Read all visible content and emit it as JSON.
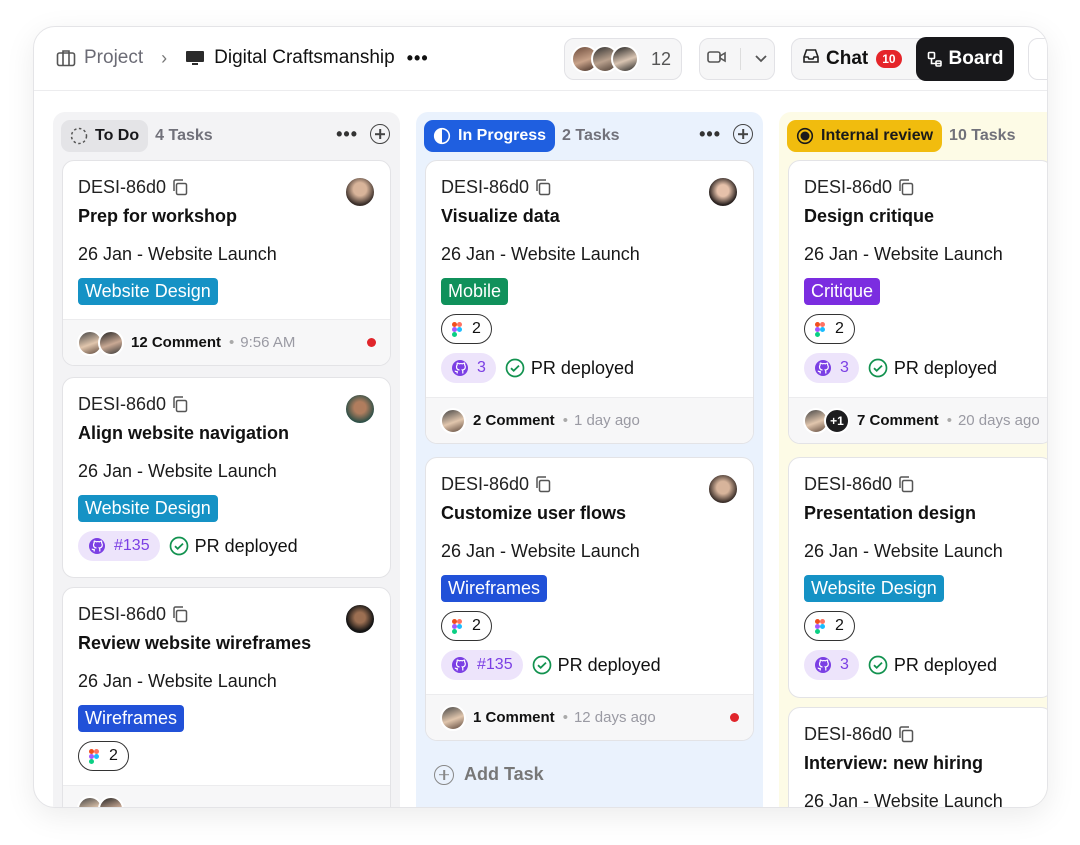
{
  "breadcrumb": {
    "root": "Project",
    "current": "Digital Craftsmanship"
  },
  "header": {
    "member_count": "12",
    "chat_label": "Chat",
    "chat_badge": "10",
    "board_label": "Board"
  },
  "columns": [
    {
      "title": "To Do",
      "count": "4 Tasks",
      "color": "#e4e4e7"
    },
    {
      "title": "In Progress",
      "count": "2 Tasks",
      "color": "#1f5fe0"
    },
    {
      "title": "Internal review",
      "count": "10 Tasks",
      "color": "#f1bc0e"
    }
  ],
  "todo": [
    {
      "id": "DESI-86d0",
      "title": "Prep for workshop",
      "date": "26 Jan - Website Launch",
      "tag": "Website Design",
      "comments": "12 Comment",
      "time": "9:56 AM"
    },
    {
      "id": "DESI-86d0",
      "title": "Align website navigation",
      "date": "26 Jan - Website Launch",
      "tag": "Website Design",
      "pr": "#135",
      "pr_status": "PR deployed"
    },
    {
      "id": "DESI-86d0",
      "title": "Review website wireframes",
      "date": "26 Jan - Website Launch",
      "tag": "Wireframes",
      "figma": "2"
    }
  ],
  "progress": [
    {
      "id": "DESI-86d0",
      "title": "Visualize data",
      "date": "26 Jan - Website Launch",
      "tag": "Mobile",
      "figma": "2",
      "pr": "3",
      "pr_status": "PR deployed",
      "comments": "2 Comment",
      "time": "1 day ago"
    },
    {
      "id": "DESI-86d0",
      "title": "Customize user flows",
      "date": "26 Jan - Website Launch",
      "tag": "Wireframes",
      "figma": "2",
      "pr": "#135",
      "pr_status": "PR deployed",
      "comments": "1 Comment",
      "time": "12 days ago"
    }
  ],
  "review": [
    {
      "id": "DESI-86d0",
      "title": "Design critique",
      "date": "26 Jan - Website Launch",
      "tag": "Critique",
      "figma": "2",
      "pr": "3",
      "pr_status": "PR deployed",
      "extra_avatars": "+1",
      "comments": "7 Comment",
      "time": "20 days ago"
    },
    {
      "id": "DESI-86d0",
      "title": "Presentation design",
      "date": "26 Jan - Website Launch",
      "tag": "Website Design",
      "figma": "2",
      "pr": "3",
      "pr_status": "PR deployed"
    },
    {
      "id": "DESI-86d0",
      "title": "Interview: new hiring",
      "date": "26 Jan - Website Launch"
    }
  ],
  "add_task_label": "Add Task",
  "colors": {
    "tag_blue": "#1592c5",
    "tag_green": "#10915b",
    "tag_purple": "#7b2de0",
    "tag_navy": "#2151d8",
    "badge_red": "#e5252a"
  }
}
